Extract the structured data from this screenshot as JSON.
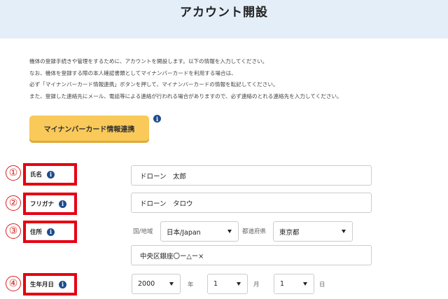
{
  "page": {
    "title": "アカウント開設"
  },
  "intro": {
    "lines": [
      "機体の登録手続きや管理をするために、アカウントを開設します。以下の情報を入力してください。",
      "なお、機体を登録する際の本人確認書類としてマイナンバーカードを利用する場合は、",
      "必ず「マイナンバーカード情報連携」ボタンを押して、マイナンバーカードの情報を転記してください。",
      "また、登録した連絡先にメール、電話等による連絡が行われる場合がありますので、必ず連絡のとれる連絡先を入力してください。"
    ]
  },
  "mynumber_button": {
    "label": "マイナンバーカード情報連携"
  },
  "info_icon_glyph": "i",
  "form": {
    "name": {
      "step": "①",
      "label": "氏名",
      "value": "ドローン　太郎"
    },
    "furigana": {
      "step": "②",
      "label": "フリガナ",
      "value": "ドローン　タロウ"
    },
    "address": {
      "step": "③",
      "label": "住所",
      "country_label": "国/地域",
      "country_value": "日本/Japan",
      "prefecture_label": "都道府県",
      "prefecture_value": "東京都",
      "street_value": "中央区銀座〇ー△ー×"
    },
    "birthdate": {
      "step": "④",
      "label": "生年月日",
      "year_value": "2000",
      "year_unit": "年",
      "month_value": "1",
      "month_unit": "月",
      "day_value": "1",
      "day_unit": "日"
    }
  },
  "colors": {
    "header_bg": "#e3eef8",
    "button_bg": "#f9c95a",
    "highlight_red": "#e60012",
    "info_icon": "#1e4d8c"
  }
}
